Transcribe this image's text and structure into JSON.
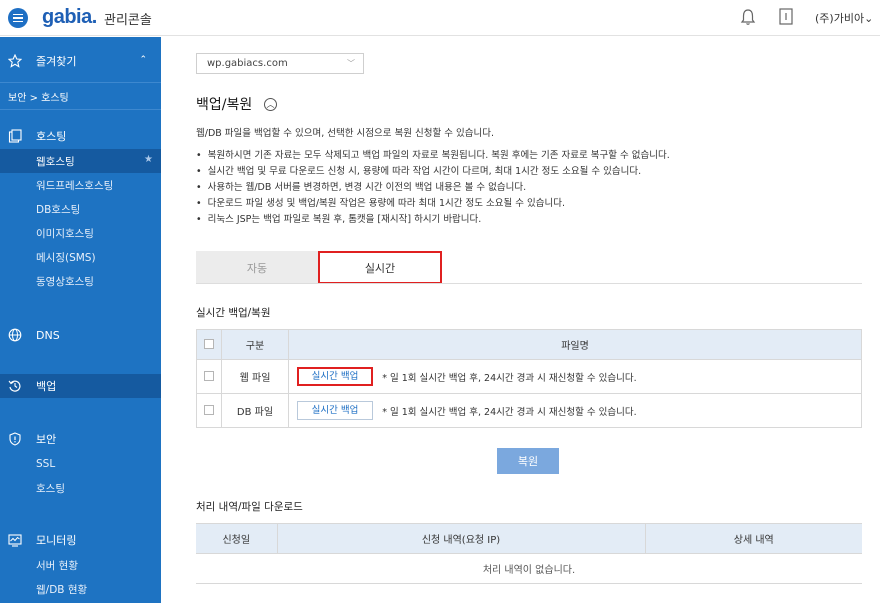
{
  "header": {
    "logo": "gabia.",
    "console_label": "관리콘솔",
    "user_name": "(주)가비아",
    "user_caret": "⌄"
  },
  "sidebar": {
    "favorites": "즐겨찾기",
    "favorites_caret": "⌃",
    "breadcrumb": "보안 > 호스팅",
    "hosting": {
      "label": "호스팅",
      "items": [
        "웹호스팅",
        "워드프레스호스팅",
        "DB호스팅",
        "이미지호스팅",
        "메시징(SMS)",
        "동영상호스팅"
      ]
    },
    "dns": "DNS",
    "backup": "백업",
    "security": {
      "label": "보안",
      "items": [
        "SSL",
        "호스팅"
      ]
    },
    "monitoring": {
      "label": "모니터링",
      "items": [
        "서버 현황",
        "웹/DB 현황"
      ]
    }
  },
  "main": {
    "site_select": "wp.gabiacs.com",
    "title": "백업/복원",
    "intro": "웹/DB 파일을 백업할 수 있으며, 선택한 시점으로 복원 신청할 수 있습니다.",
    "notices": [
      "복원하시면 기존 자료는 모두 삭제되고 백업 파일의 자료로 복원됩니다. 복원 후에는 기존 자료로 복구할 수 없습니다.",
      "실시간 백업 및 무료 다운로드 신청 시, 용량에 따라 작업 시간이 다르며, 최대 1시간 정도 소요될 수 있습니다.",
      "사용하는 웹/DB 서버를 변경하면, 변경 시간 이전의 백업 내용은 볼 수 없습니다.",
      "다운로드 파일 생성 및 백업/복원 작업은 용량에 따라 최대 1시간 정도 소요될 수 있습니다.",
      "리눅스 JSP는 백업 파일로 복원 후, 톰캣을 [재시작] 하시기 바랍니다."
    ],
    "tabs": {
      "auto": "자동",
      "realtime": "실시간"
    },
    "realtime_heading": "실시간 백업/복원",
    "table": {
      "col_type": "구분",
      "col_filename": "파일명",
      "rows": [
        {
          "type": "웹 파일",
          "button": "실시간 백업",
          "note": "* 일 1회 실시간 백업 후, 24시간 경과 시 재신청할 수 있습니다."
        },
        {
          "type": "DB 파일",
          "button": "실시간 백업",
          "note": "* 일 1회 실시간 백업 후, 24시간 경과 시 재신청할 수 있습니다."
        }
      ]
    },
    "restore_button": "복원",
    "history_heading": "처리 내역/파일 다운로드",
    "history": {
      "col_date": "신청일",
      "col_request": "신청 내역(요청 IP)",
      "col_detail": "상세 내역",
      "empty": "처리 내역이 없습니다."
    }
  },
  "colors": {
    "sidebar_bg": "#1e73c2",
    "sidebar_active": "#155aa0",
    "highlight_red": "#e02020",
    "table_header": "#e3ecf6",
    "restore_button": "#7ba8de"
  }
}
